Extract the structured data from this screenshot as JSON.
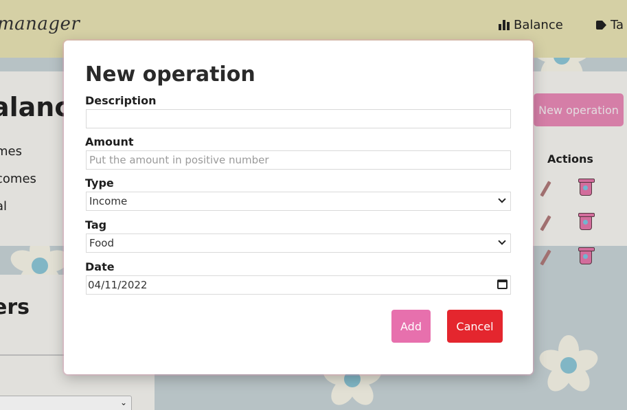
{
  "navbar": {
    "brand": "manager",
    "links": [
      {
        "label": "Balance",
        "icon": "bar-chart-icon"
      },
      {
        "label": "Ta",
        "icon": "tag-icon"
      }
    ]
  },
  "balance": {
    "title": "alance",
    "rows": [
      "mes",
      "comes",
      "al"
    ],
    "new_operation_label": "New operation",
    "actions_header": "Actions"
  },
  "filters": {
    "title": "ers"
  },
  "modal": {
    "title": "New operation",
    "fields": {
      "description": {
        "label": "Description",
        "value": ""
      },
      "amount": {
        "label": "Amount",
        "placeholder": "Put the amount in positive number"
      },
      "type": {
        "label": "Type",
        "value": "Income"
      },
      "tag": {
        "label": "Tag",
        "value": "Food"
      },
      "date": {
        "label": "Date",
        "value": "04/11/2022"
      }
    },
    "buttons": {
      "add": "Add",
      "cancel": "Cancel"
    }
  },
  "colors": {
    "navbar": "#e8e2b3",
    "pink_button": "#e770ad",
    "cancel_red": "#e4262e",
    "background": "#c7d3d6"
  }
}
